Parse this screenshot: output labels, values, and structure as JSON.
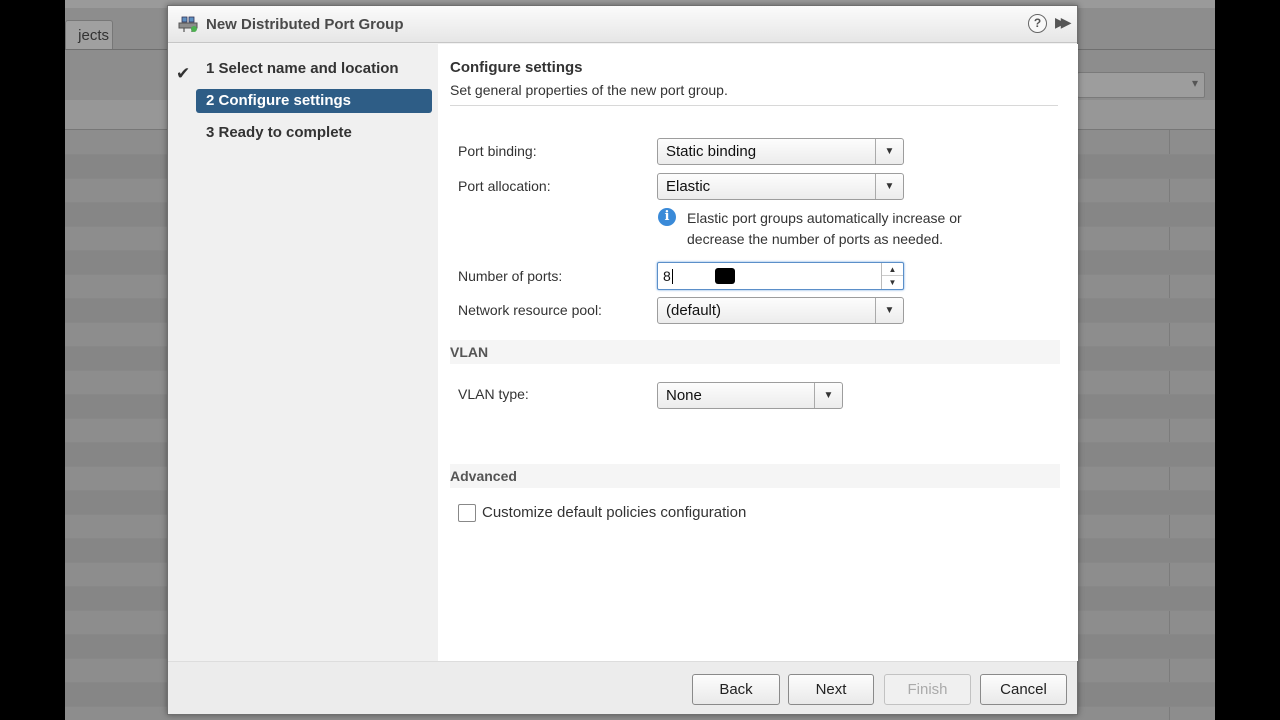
{
  "background": {
    "tab_label": "jects"
  },
  "dialog": {
    "title": "New Distributed Port Group",
    "help_label": "?",
    "expand_label": "▶▶"
  },
  "nav": {
    "check_mark": "✔",
    "items": [
      {
        "label": "1  Select name and location",
        "state": "completed"
      },
      {
        "label": "2  Configure settings",
        "state": "active"
      },
      {
        "label": "3  Ready to complete",
        "state": "pending"
      }
    ]
  },
  "content": {
    "title": "Configure settings",
    "subtitle": "Set general properties of the new port group.",
    "port_binding": {
      "label": "Port binding:",
      "value": "Static binding"
    },
    "port_allocation": {
      "label": "Port allocation:",
      "value": "Elastic"
    },
    "info_text": "Elastic port groups automatically increase or decrease the number of ports as needed.",
    "number_of_ports": {
      "label": "Number of ports:",
      "value": "8"
    },
    "network_resource_pool": {
      "label": "Network resource pool:",
      "value": "(default)"
    },
    "vlan_section": "VLAN",
    "vlan_type": {
      "label": "VLAN type:",
      "value": "None"
    },
    "advanced_section": "Advanced",
    "customize_label": "Customize default policies configuration",
    "customize_checked": false
  },
  "footer": {
    "back_label": "Back",
    "next_label": "Next",
    "finish_label": "Finish",
    "cancel_label": "Cancel"
  },
  "colors": {
    "active_nav": "#2e5d86",
    "info_icon": "#3a8ad8"
  }
}
